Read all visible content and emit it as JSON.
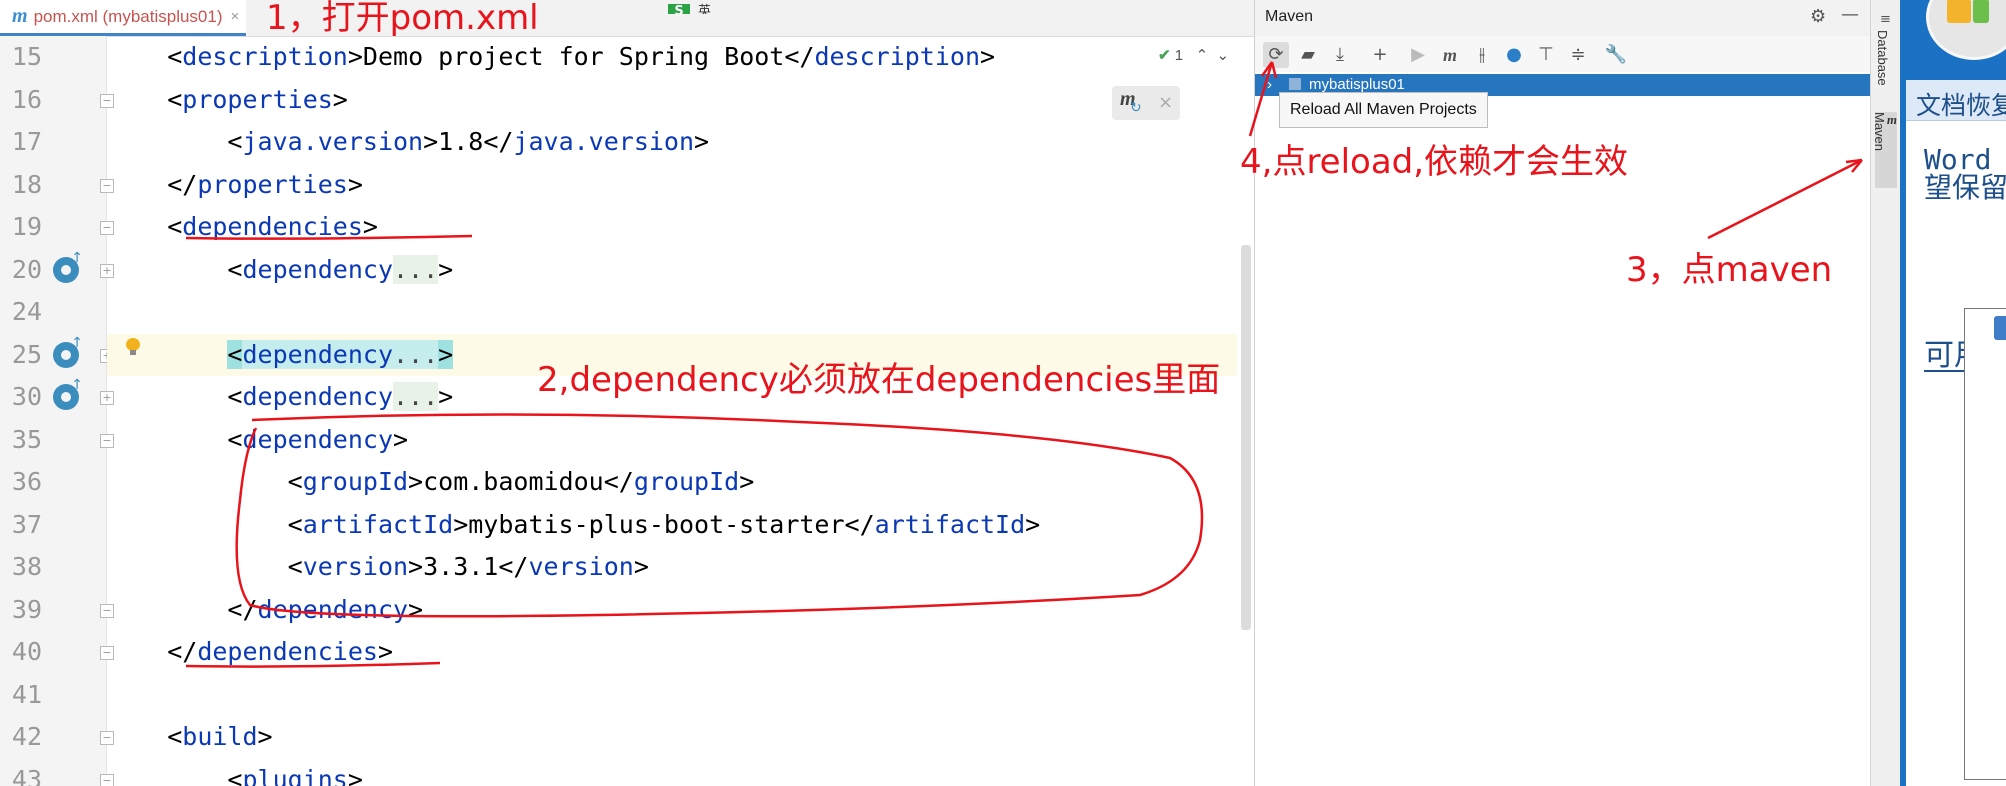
{
  "editor": {
    "tab": {
      "icon": "maven-file-icon",
      "label": "pom.xml (mybatisplus01)",
      "close": "×"
    },
    "inspections": {
      "count": "1"
    },
    "lines": [
      {
        "n": "15",
        "pre": "    ",
        "parts": [
          [
            "p",
            "<"
          ],
          [
            "t",
            "description"
          ],
          [
            "p",
            ">Demo project for Spring Boot</"
          ],
          [
            "t",
            "description"
          ],
          [
            "p",
            ">"
          ]
        ]
      },
      {
        "n": "16",
        "pre": "    ",
        "parts": [
          [
            "p",
            "<"
          ],
          [
            "t",
            "properties"
          ],
          [
            "p",
            ">"
          ]
        ]
      },
      {
        "n": "17",
        "pre": "        ",
        "parts": [
          [
            "p",
            "<"
          ],
          [
            "t",
            "java.version"
          ],
          [
            "p",
            ">1.8</"
          ],
          [
            "t",
            "java.version"
          ],
          [
            "p",
            ">"
          ]
        ]
      },
      {
        "n": "18",
        "pre": "    ",
        "parts": [
          [
            "p",
            "</"
          ],
          [
            "t",
            "properties"
          ],
          [
            "p",
            ">"
          ]
        ]
      },
      {
        "n": "19",
        "pre": "    ",
        "parts": [
          [
            "p",
            "<"
          ],
          [
            "t",
            "dependencies"
          ],
          [
            "p",
            ">"
          ]
        ]
      },
      {
        "n": "20",
        "pre": "        ",
        "parts": [
          [
            "p",
            "<"
          ],
          [
            "t",
            "dependency"
          ],
          [
            "f",
            "..."
          ],
          [
            "p",
            ">"
          ]
        ]
      },
      {
        "n": "24",
        "pre": "",
        "parts": []
      },
      {
        "n": "25",
        "pre": "        ",
        "parts": [
          [
            "h",
            "<"
          ],
          [
            "th",
            "dependency"
          ],
          [
            "fh",
            "..."
          ],
          [
            "h",
            ">"
          ]
        ]
      },
      {
        "n": "30",
        "pre": "        ",
        "parts": [
          [
            "p",
            "<"
          ],
          [
            "t",
            "dependency"
          ],
          [
            "f",
            "..."
          ],
          [
            "p",
            ">"
          ]
        ]
      },
      {
        "n": "35",
        "pre": "        ",
        "parts": [
          [
            "p",
            "<"
          ],
          [
            "t",
            "dependency"
          ],
          [
            "p",
            ">"
          ]
        ]
      },
      {
        "n": "36",
        "pre": "            ",
        "parts": [
          [
            "p",
            "<"
          ],
          [
            "t",
            "groupId"
          ],
          [
            "p",
            ">com.baomidou</"
          ],
          [
            "t",
            "groupId"
          ],
          [
            "p",
            ">"
          ]
        ]
      },
      {
        "n": "37",
        "pre": "            ",
        "parts": [
          [
            "p",
            "<"
          ],
          [
            "t",
            "artifactId"
          ],
          [
            "p",
            ">mybatis-plus-boot-starter</"
          ],
          [
            "t",
            "artifactId"
          ],
          [
            "p",
            ">"
          ]
        ]
      },
      {
        "n": "38",
        "pre": "            ",
        "parts": [
          [
            "p",
            "<"
          ],
          [
            "t",
            "version"
          ],
          [
            "p",
            ">3.3.1</"
          ],
          [
            "t",
            "version"
          ],
          [
            "p",
            ">"
          ]
        ]
      },
      {
        "n": "39",
        "pre": "        ",
        "parts": [
          [
            "p",
            "</"
          ],
          [
            "t",
            "dependency"
          ],
          [
            "p",
            ">"
          ]
        ]
      },
      {
        "n": "40",
        "pre": "    ",
        "parts": [
          [
            "p",
            "</"
          ],
          [
            "t",
            "dependencies"
          ],
          [
            "p",
            ">"
          ]
        ]
      },
      {
        "n": "41",
        "pre": "",
        "parts": []
      },
      {
        "n": "42",
        "pre": "    ",
        "parts": [
          [
            "p",
            "<"
          ],
          [
            "t",
            "build"
          ],
          [
            "p",
            ">"
          ]
        ]
      },
      {
        "n": "43",
        "pre": "        ",
        "parts": [
          [
            "p",
            "<"
          ],
          [
            "t",
            "plugins"
          ],
          [
            "p",
            ">"
          ]
        ]
      }
    ]
  },
  "ime": {
    "lang": "英"
  },
  "maven": {
    "title": "Maven",
    "project": "mybatisplus01",
    "tooltip": "Reload All Maven Projects",
    "toolbar": [
      "reload-icon",
      "add-folder-icon",
      "download-icon",
      "plus-icon",
      "run-icon",
      "maven-goal-icon",
      "toggle-offline-icon",
      "skip-tests-icon",
      "show-dependencies-icon",
      "collapse-icon",
      "settings-wrench-icon"
    ]
  },
  "strip": {
    "database": "Database",
    "maven": "Maven"
  },
  "bgwindow": {
    "title": "文档恢复",
    "text1a": "Word",
    "text1b": "望保留",
    "text2": "可用文"
  },
  "annotations": {
    "a1": "1，打开pom.xml",
    "a2": "2,dependency必须放在dependencies里面",
    "a3": "3，点maven",
    "a4": "4,点reload,依赖才会生效"
  },
  "colors": {
    "annotation": "#e8131b",
    "tag": "#0b38b5",
    "selection": "#2675bf"
  }
}
